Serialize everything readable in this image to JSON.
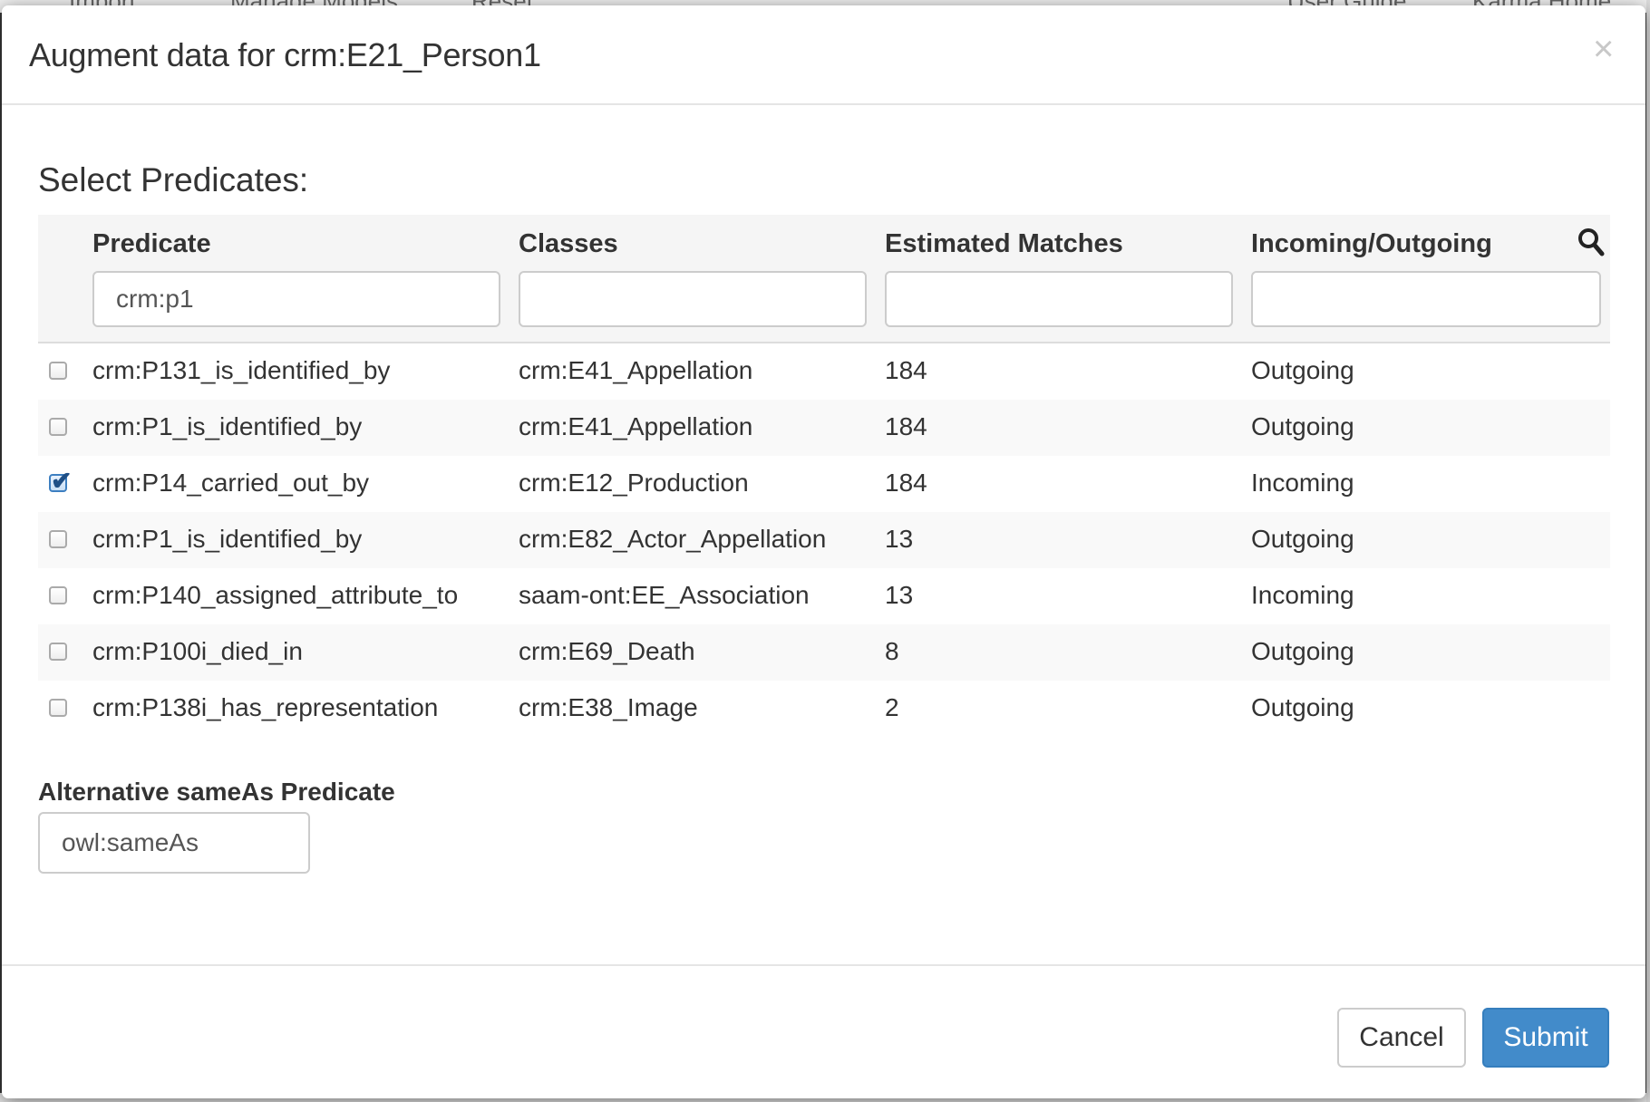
{
  "background_nav": {
    "items": [
      "Import",
      "Manage Models",
      "Reset ...",
      "User Guide",
      "Karma Home"
    ]
  },
  "modal": {
    "title": "Augment data for crm:E21_Person1",
    "close_glyph": "×",
    "section_title": "Select Predicates:",
    "table": {
      "columns": [
        "Predicate",
        "Classes",
        "Estimated Matches",
        "Incoming/Outgoing"
      ],
      "filters": {
        "predicate": "crm:p1",
        "classes": "",
        "estimated_matches": "",
        "direction": ""
      },
      "rows": [
        {
          "checked": false,
          "predicate": "crm:P131_is_identified_by",
          "classes": "crm:E41_Appellation",
          "matches": "184",
          "direction": "Outgoing"
        },
        {
          "checked": false,
          "predicate": "crm:P1_is_identified_by",
          "classes": "crm:E41_Appellation",
          "matches": "184",
          "direction": "Outgoing"
        },
        {
          "checked": true,
          "predicate": "crm:P14_carried_out_by",
          "classes": "crm:E12_Production",
          "matches": "184",
          "direction": "Incoming"
        },
        {
          "checked": false,
          "predicate": "crm:P1_is_identified_by",
          "classes": "crm:E82_Actor_Appellation",
          "matches": "13",
          "direction": "Outgoing"
        },
        {
          "checked": false,
          "predicate": "crm:P140_assigned_attribute_to",
          "classes": "saam-ont:EE_Association",
          "matches": "13",
          "direction": "Incoming"
        },
        {
          "checked": false,
          "predicate": "crm:P100i_died_in",
          "classes": "crm:E69_Death",
          "matches": "8",
          "direction": "Outgoing"
        },
        {
          "checked": false,
          "predicate": "crm:P138i_has_representation",
          "classes": "crm:E38_Image",
          "matches": "2",
          "direction": "Outgoing"
        }
      ]
    },
    "alt_sameas": {
      "label": "Alternative sameAs Predicate",
      "value": "owl:sameAs"
    },
    "footer": {
      "cancel_label": "Cancel",
      "submit_label": "Submit"
    }
  },
  "icons": {
    "search": "search-icon",
    "close": "close-icon",
    "check": "checkmark-icon"
  },
  "colors": {
    "primary": "#428bca",
    "header_bg": "#f5f5f5",
    "striped_row": "#f9f9f9",
    "border": "#dddddd"
  }
}
